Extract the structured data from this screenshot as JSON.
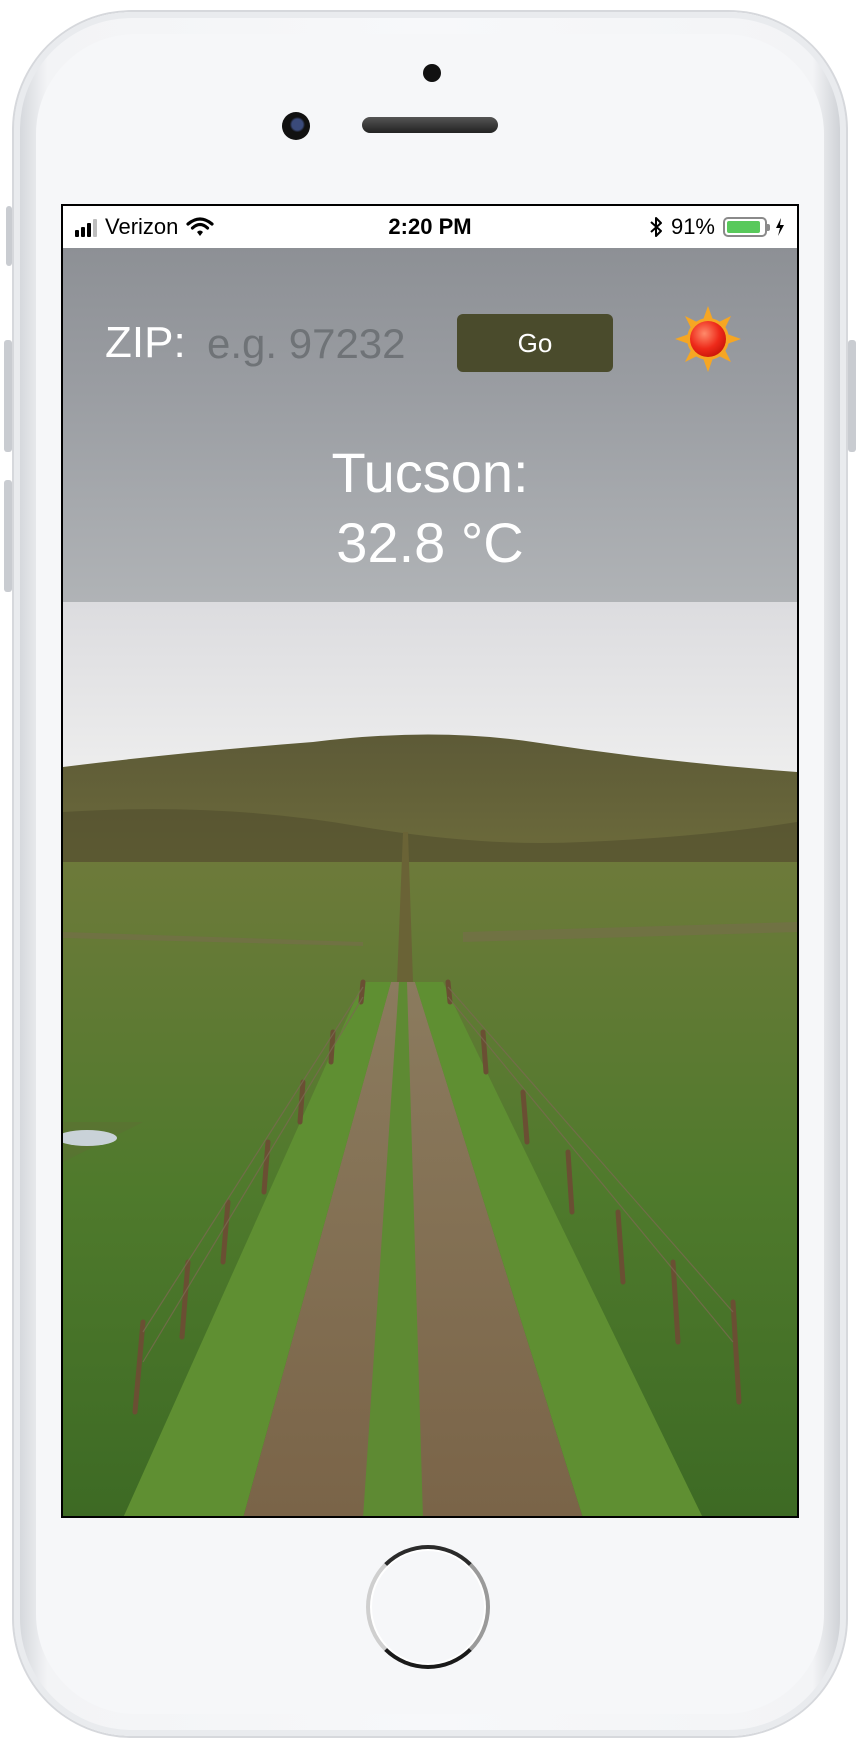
{
  "status_bar": {
    "carrier": "Verizon",
    "time": "2:20 PM",
    "battery_percent": "91%",
    "battery_level": 0.91,
    "icons": [
      "signal-icon",
      "wifi-icon",
      "bluetooth-icon",
      "battery-icon",
      "charging-icon"
    ]
  },
  "weather": {
    "zip_label": "ZIP:",
    "zip_placeholder": "e.g. 97232",
    "go_label": "Go",
    "city": "Tucson:",
    "temperature": "32.8 °C",
    "condition_icon": "sun-icon"
  },
  "colors": {
    "header_overlay": "#9a9da2",
    "go_button": "#4a4b2c",
    "battery_fill": "#58c95b"
  }
}
